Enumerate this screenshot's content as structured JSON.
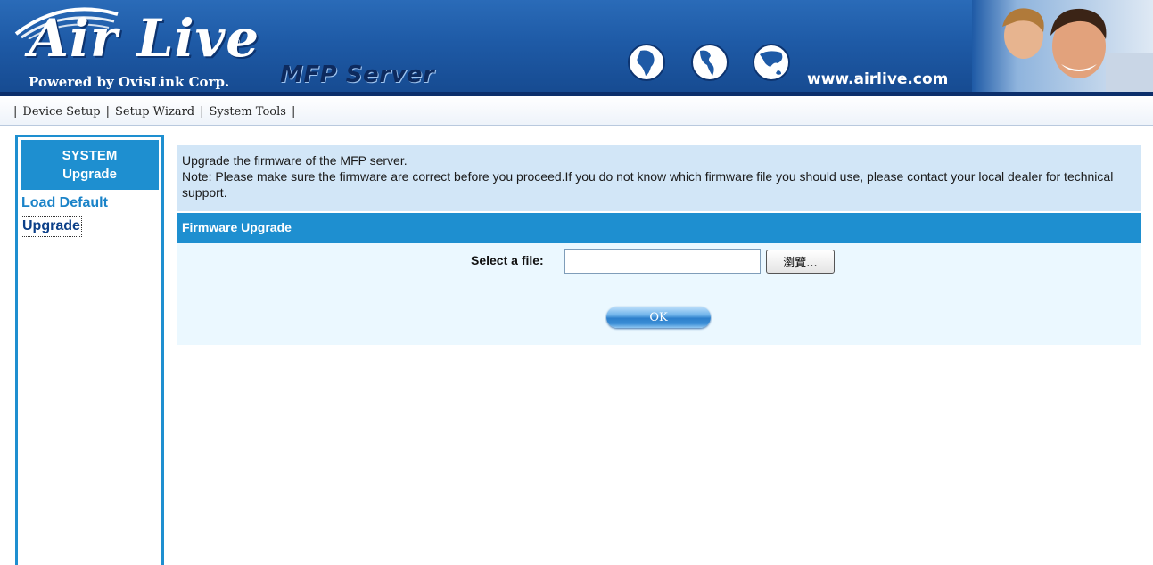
{
  "header": {
    "brand": "Air Live",
    "registered_mark": "®",
    "tagline": "Powered by OvisLink Corp.",
    "product_name": "MFP Server",
    "website": "www.airlive.com",
    "icons": [
      "globe-africa-icon",
      "globe-americas-icon",
      "globe-asia-icon"
    ]
  },
  "topnav": {
    "separator": "|",
    "items": [
      {
        "label": "Device Setup"
      },
      {
        "label": "Setup Wizard"
      },
      {
        "label": "System Tools"
      }
    ]
  },
  "sidebar": {
    "heading_line1": "SYSTEM",
    "heading_line2": "Upgrade",
    "links": [
      {
        "label": "Load Default",
        "active": false
      },
      {
        "label": "Upgrade",
        "active": true
      }
    ]
  },
  "main": {
    "notice_line1": "Upgrade the firmware of the MFP server.",
    "notice_line2": "Note: Please make sure the firmware are correct before you proceed.If you do not know which firmware file you should use, please contact your local dealer for technical support.",
    "section_title": "Firmware Upgrade",
    "file_label": "Select a file:",
    "file_value": "",
    "browse_label": "瀏覽...",
    "ok_label": "OK"
  },
  "colors": {
    "banner_blue": "#1e5aa6",
    "accent_blue": "#1e8fd0",
    "notice_bg": "#d2e6f7",
    "form_bg": "#ebf8ff"
  }
}
